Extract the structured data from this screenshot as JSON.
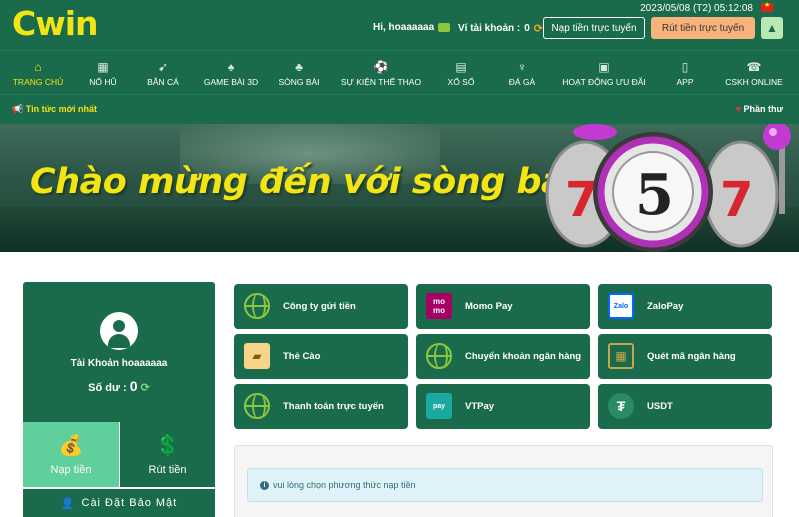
{
  "header": {
    "logo": "Cwin",
    "datetime": "2023/05/08 (T2) 05:12:08",
    "greeting": "Hi, hoaaaaaa",
    "wallet_label": "Ví tài khoản :",
    "wallet_value": "0",
    "deposit_button": "Nạp tiền trực tuyến",
    "withdraw_button": "Rút tiền trực tuyến",
    "up_icon": "▲"
  },
  "nav": {
    "items": [
      {
        "label": "TRANG CHỦ",
        "icon": "⌂"
      },
      {
        "label": "NỔ HŨ",
        "icon": "▦"
      },
      {
        "label": "BẮN CÁ",
        "icon": "➹"
      },
      {
        "label": "GAME BÀI 3D",
        "icon": "♠"
      },
      {
        "label": "SÒNG BÀI",
        "icon": "♣"
      },
      {
        "label": "SỰ KIỆN THỂ THAO",
        "icon": "⚽"
      },
      {
        "label": "XỔ SỐ",
        "icon": "▤"
      },
      {
        "label": "ĐÁ GÀ",
        "icon": "♆"
      },
      {
        "label": "HOẠT ĐỘNG ƯU ĐÃI",
        "icon": "▣"
      },
      {
        "label": "APP",
        "icon": "▯"
      },
      {
        "label": "CSKH ONLINE",
        "icon": "☎"
      }
    ]
  },
  "newsbar": {
    "left": "Tin tức mới nhất",
    "right": "Phần thư"
  },
  "banner": {
    "title": "Chào mừng đến với sòng bạc"
  },
  "account": {
    "name": "Tài Khoản hoaaaaaa",
    "balance_label": "Số dư :",
    "balance_value": "0",
    "deposit_tile": "Nạp tiền",
    "withdraw_tile": "Rút tiền",
    "security": "Cài Đặt Bảo Mật"
  },
  "payments": [
    {
      "label": "Công ty gửi tiền",
      "icon": "globe-icon"
    },
    {
      "label": "Momo Pay",
      "icon": "momo-icon"
    },
    {
      "label": "ZaloPay",
      "icon": "zalopay-icon"
    },
    {
      "label": "Thẻ Cào",
      "icon": "scratch-card-icon"
    },
    {
      "label": "Chuyển khoản ngân hàng",
      "icon": "globe-icon"
    },
    {
      "label": "Quét mã ngân hàng",
      "icon": "qr-code-icon"
    },
    {
      "label": "Thanh toán trực tuyến",
      "icon": "globe-icon"
    },
    {
      "label": "VTPay",
      "icon": "vtpay-icon"
    },
    {
      "label": "USDT",
      "icon": "usdt-icon"
    }
  ],
  "info": {
    "message": "vui lòng chọn phương thức nạp tiền"
  },
  "colors": {
    "primary_green": "#1a6b4c",
    "accent_yellow": "#f3e513",
    "light_green": "#5fcf9c",
    "withdraw_orange": "#f7b37b"
  }
}
